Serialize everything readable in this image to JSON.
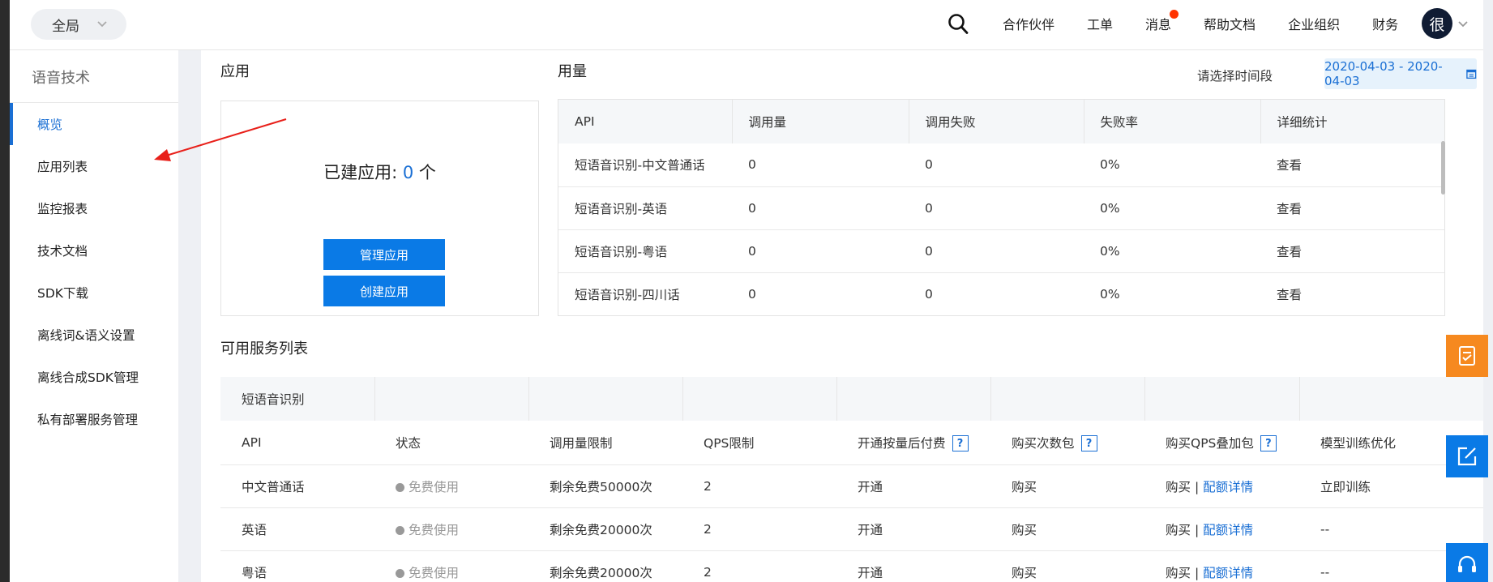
{
  "header": {
    "scope_label": "全局",
    "nav": [
      {
        "label": "合作伙伴"
      },
      {
        "label": "工单"
      },
      {
        "label": "消息"
      },
      {
        "label": "帮助文档"
      },
      {
        "label": "企业组织"
      },
      {
        "label": "财务"
      }
    ],
    "avatar_text": "很"
  },
  "sidebar": {
    "title": "语音技术",
    "items": [
      {
        "label": "概览"
      },
      {
        "label": "应用列表"
      },
      {
        "label": "监控报表"
      },
      {
        "label": "技术文档"
      },
      {
        "label": "SDK下载"
      },
      {
        "label": "离线词&语义设置"
      },
      {
        "label": "离线合成SDK管理"
      },
      {
        "label": "私有部署服务管理"
      }
    ]
  },
  "apps": {
    "title": "应用",
    "count_prefix": "已建应用: ",
    "count": "0",
    "count_suffix": " 个",
    "manage_label": "管理应用",
    "create_label": "创建应用"
  },
  "usage": {
    "title": "用量",
    "range_label": "请选择时间段",
    "date_range": "2020-04-03 - 2020-04-03",
    "columns": [
      "API",
      "调用量",
      "调用失败",
      "失败率",
      "详细统计"
    ],
    "rows": [
      {
        "api": "短语音识别-中文普通话",
        "calls": "0",
        "fails": "0",
        "rate": "0%",
        "detail": "查看"
      },
      {
        "api": "短语音识别-英语",
        "calls": "0",
        "fails": "0",
        "rate": "0%",
        "detail": "查看"
      },
      {
        "api": "短语音识别-粤语",
        "calls": "0",
        "fails": "0",
        "rate": "0%",
        "detail": "查看"
      },
      {
        "api": "短语音识别-四川话",
        "calls": "0",
        "fails": "0",
        "rate": "0%",
        "detail": "查看"
      }
    ]
  },
  "services": {
    "title": "可用服务列表",
    "group": "短语音识别",
    "columns": [
      "API",
      "状态",
      "调用量限制",
      "QPS限制",
      "开通按量后付费",
      "购买次数包",
      "购买QPS叠加包",
      "模型训练优化"
    ],
    "help_mark": "?",
    "rows": [
      {
        "api": "中文普通话",
        "status": "免费使用",
        "limit": "剩余免费50000次",
        "qps": "2",
        "postpay": "开通",
        "pack": "购买",
        "qps_buy": "购买",
        "sep": "|",
        "quota": "配额详情",
        "train": "立即训练"
      },
      {
        "api": "英语",
        "status": "免费使用",
        "limit": "剩余免费20000次",
        "qps": "2",
        "postpay": "开通",
        "pack": "购买",
        "qps_buy": "购买",
        "sep": "|",
        "quota": "配额详情",
        "train": "--"
      },
      {
        "api": "粤语",
        "status": "免费使用",
        "limit": "剩余免费20000次",
        "qps": "2",
        "postpay": "开通",
        "pack": "购买",
        "qps_buy": "购买",
        "sep": "|",
        "quota": "配额详情",
        "train": "--"
      }
    ]
  },
  "colors": {
    "accent": "#1a6fd4",
    "button_blue": "#0a7ae6",
    "float_orange": "#f6891f",
    "badge_red": "#ff3300",
    "annotation_arrow": "#e8201a"
  },
  "icons": [
    "search-icon",
    "chevron-down-icon",
    "calendar-icon",
    "feedback-icon",
    "edit-icon",
    "headset-icon"
  ]
}
